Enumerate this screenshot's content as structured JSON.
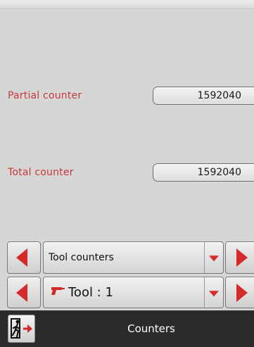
{
  "counters": {
    "partial_label": "Partial counter",
    "partial_value": "1592040",
    "total_label": "Total counter",
    "total_value": "1592040"
  },
  "selectors": {
    "counter_type": "Tool counters",
    "tool": "Tool : 1"
  },
  "footer": {
    "title": "Counters",
    "exit_icon": "exit-door-icon"
  },
  "colors": {
    "accent_red": "#d42a2a",
    "label_red": "#c43a3a",
    "footer_bg": "#2b2b2b",
    "screen_bg": "#d6d6d6"
  }
}
